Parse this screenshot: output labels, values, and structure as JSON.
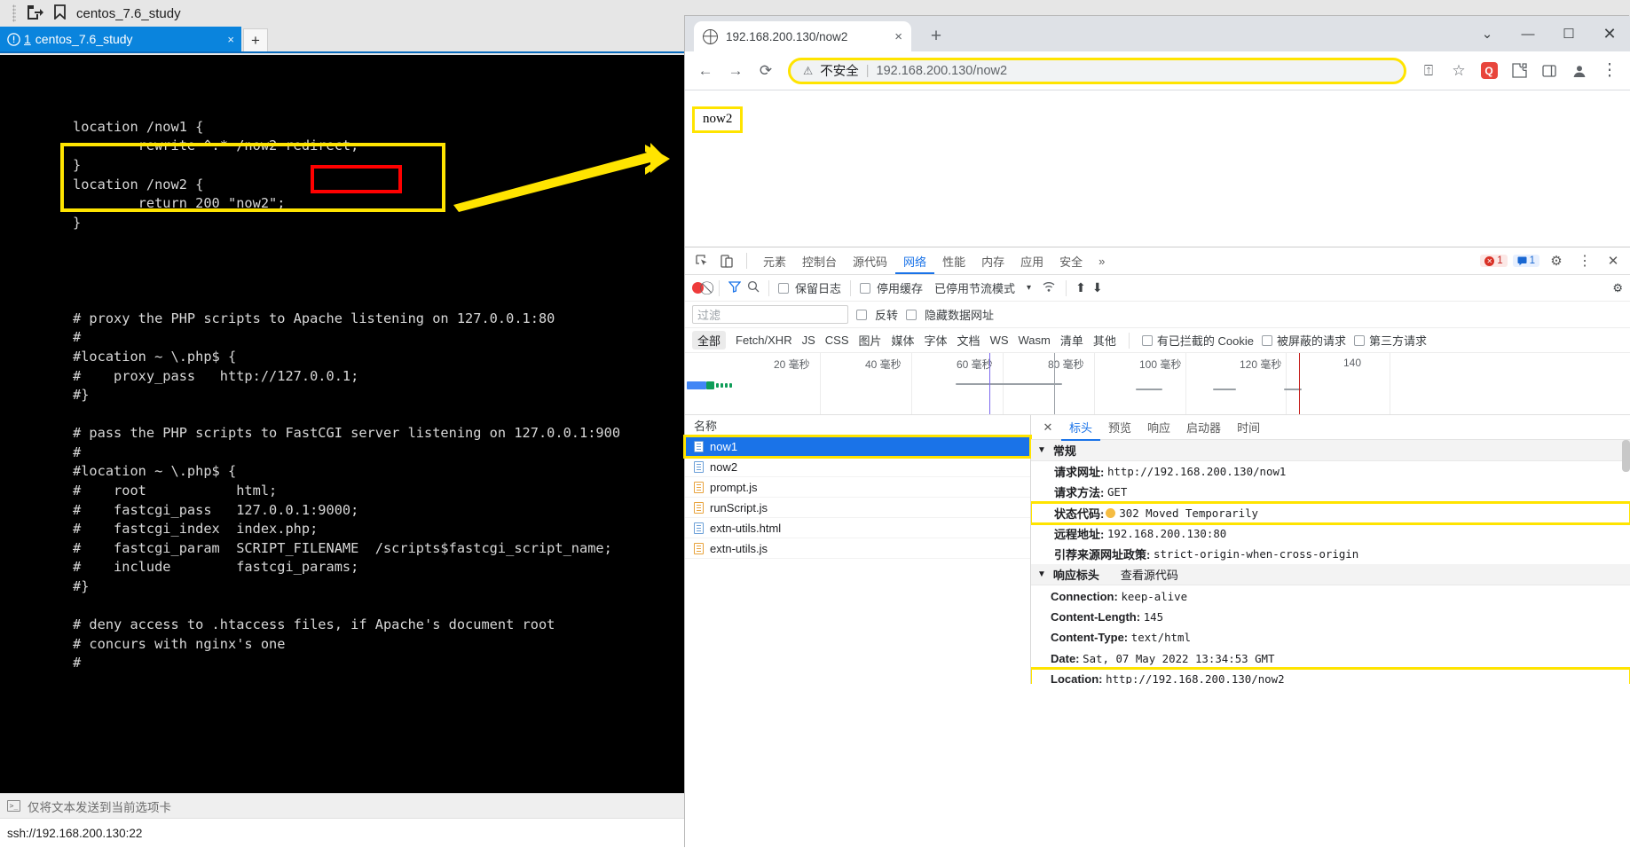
{
  "terminal": {
    "title": "centos_7.6_study",
    "tab": {
      "warn_icon": "!",
      "number": "1",
      "label": "centos_7.6_study",
      "close": "×"
    },
    "new_tab": "+",
    "lines": [
      "",
      "location /now1 {",
      "        rewrite ^.* /now2 redirect;",
      "}",
      "location /now2 {",
      "        return 200 \"now2\";",
      "}",
      "",
      "",
      "",
      "",
      "# proxy the PHP scripts to Apache listening on 127.0.0.1:80",
      "#",
      "#location ~ \\.php$ {",
      "#    proxy_pass   http://127.0.0.1;",
      "#}",
      "",
      "# pass the PHP scripts to FastCGI server listening on 127.0.0.1:900",
      "#",
      "#location ~ \\.php$ {",
      "#    root           html;",
      "#    fastcgi_pass   127.0.0.1:9000;",
      "#    fastcgi_index  index.php;",
      "#    fastcgi_param  SCRIPT_FILENAME  /scripts$fastcgi_script_name;",
      "#    include        fastcgi_params;",
      "#}",
      "",
      "# deny access to .htaccess files, if Apache's document root",
      "# concurs with nginx's one",
      "#"
    ],
    "status_text": "仅将文本发送到当前选项卡",
    "bottom_text": "ssh://192.168.200.130:22"
  },
  "chrome": {
    "tab": {
      "title": "192.168.200.130/now2",
      "close": "×"
    },
    "new_tab": "+",
    "window_controls": {
      "expand": "⌄",
      "minimize": "—",
      "maximize": "☐",
      "close": "✕"
    },
    "toolbar": {
      "back": "←",
      "forward": "→",
      "reload": "⟳",
      "security_label": "不安全",
      "security_icon": "⚠",
      "separator": "|",
      "url": "192.168.200.130/now2",
      "share": "⍐",
      "bookmark": "☆",
      "ext_badge": "Q",
      "puzzle": "🧩",
      "sidepanel": "▯",
      "profile": "◓",
      "menu": "⋮"
    },
    "page_text": "now2"
  },
  "devtools": {
    "tabs": [
      {
        "label": "元素",
        "active": false
      },
      {
        "label": "控制台",
        "active": false
      },
      {
        "label": "源代码",
        "active": false
      },
      {
        "label": "网络",
        "active": true
      },
      {
        "label": "性能",
        "active": false
      },
      {
        "label": "内存",
        "active": false
      },
      {
        "label": "应用",
        "active": false
      },
      {
        "label": "安全",
        "active": false
      },
      {
        "label": "»",
        "active": false
      }
    ],
    "error_count": "1",
    "message_count": "1",
    "settings_icon": "⚙",
    "more_icon": "⋮",
    "close_icon": "✕",
    "inspect_icon": "⬉",
    "device_icon": "▯",
    "network_toolbar": {
      "record": "●",
      "clear": "⃠",
      "filter": "▽",
      "search": "🔍",
      "preserve_log": "保留日志",
      "disable_cache": "停用缓存",
      "throttling": "已停用节流模式",
      "throttling_arrow": "▾",
      "wifi": "📶",
      "upload": "⬆",
      "download": "⬇",
      "settings": "⚙"
    },
    "filter_row": {
      "placeholder": "过滤",
      "invert": "反转",
      "hide_data_urls": "隐藏数据网址"
    },
    "type_filters": [
      "全部",
      "Fetch/XHR",
      "JS",
      "CSS",
      "图片",
      "媒体",
      "字体",
      "文档",
      "WS",
      "Wasm",
      "清单",
      "其他"
    ],
    "extra_filters": [
      "有已拦截的 Cookie",
      "被屏蔽的请求",
      "第三方请求"
    ],
    "timeline_ticks": [
      "20 毫秒",
      "40 毫秒",
      "60 毫秒",
      "80 毫秒",
      "100 毫秒",
      "120 毫秒",
      "140"
    ],
    "requests_header": "名称",
    "requests": [
      {
        "name": "now1",
        "type": "doc",
        "selected": true
      },
      {
        "name": "now2",
        "type": "doc",
        "selected": false
      },
      {
        "name": "prompt.js",
        "type": "js",
        "selected": false
      },
      {
        "name": "runScript.js",
        "type": "js",
        "selected": false
      },
      {
        "name": "extn-utils.html",
        "type": "doc",
        "selected": false
      },
      {
        "name": "extn-utils.js",
        "type": "js",
        "selected": false
      }
    ],
    "detail_tabs": [
      {
        "label": "标头",
        "active": true
      },
      {
        "label": "预览",
        "active": false
      },
      {
        "label": "响应",
        "active": false
      },
      {
        "label": "启动器",
        "active": false
      },
      {
        "label": "时间",
        "active": false
      }
    ],
    "detail_close": "✕",
    "general": {
      "section_title": "常规",
      "caret": "▼",
      "rows": [
        {
          "name": "请求网址:",
          "value": "http://192.168.200.130/now1",
          "highlight": false
        },
        {
          "name": "请求方法:",
          "value": "GET",
          "highlight": false
        },
        {
          "name": "状态代码:",
          "value": "302 Moved Temporarily",
          "highlight": true,
          "dot": true
        },
        {
          "name": "远程地址:",
          "value": "192.168.200.130:80",
          "highlight": false
        },
        {
          "name": "引荐来源网址政策:",
          "value": "strict-origin-when-cross-origin",
          "highlight": false
        }
      ]
    },
    "response_headers": {
      "section_title": "响应标头",
      "caret": "▼",
      "view_source": "查看源代码",
      "rows": [
        {
          "name": "Connection:",
          "value": "keep-alive",
          "highlight": false
        },
        {
          "name": "Content-Length:",
          "value": "145",
          "highlight": false
        },
        {
          "name": "Content-Type:",
          "value": "text/html",
          "highlight": false
        },
        {
          "name": "Date:",
          "value": "Sat, 07 May 2022 13:34:53 GMT",
          "highlight": false
        },
        {
          "name": "Location:",
          "value": "http://192.168.200.130/now2",
          "highlight": true
        }
      ]
    }
  },
  "annotations": {
    "highlight_color": "#ffe400",
    "error_box_color": "#ff0000",
    "accent_color": "#1a73e8"
  }
}
